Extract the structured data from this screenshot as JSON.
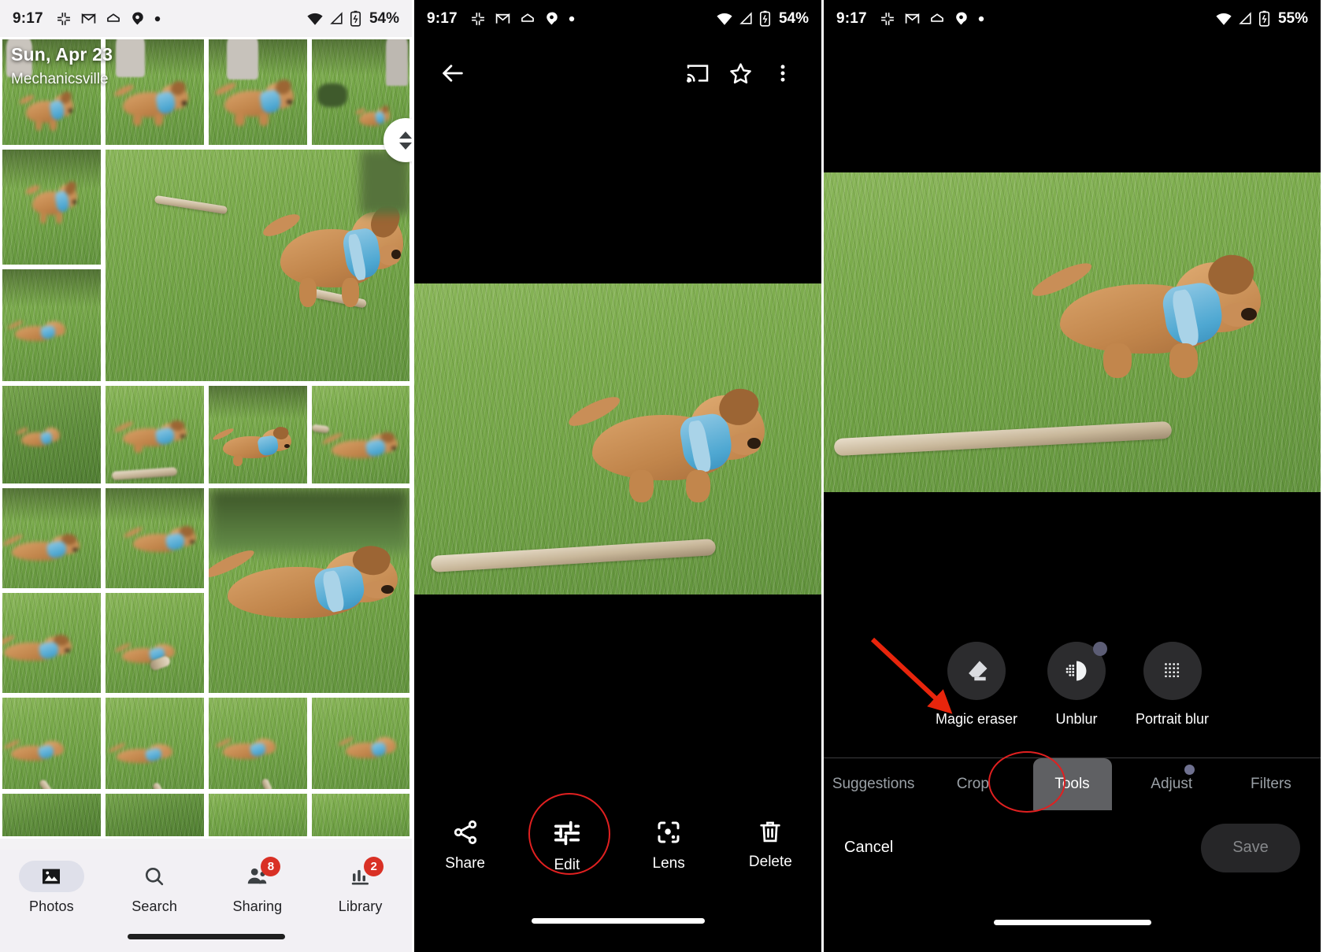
{
  "status_bars": [
    {
      "time": "9:17",
      "battery": "54%",
      "theme": "light",
      "icons": [
        "slack-icon",
        "gmail-icon",
        "home-icon",
        "maps-pin-icon",
        "dot-icon"
      ],
      "right_icons": [
        "wifi-icon",
        "signal-icon",
        "battery-charging-icon"
      ]
    },
    {
      "time": "9:17",
      "battery": "54%",
      "theme": "dark",
      "icons": [
        "slack-icon",
        "gmail-icon",
        "home-icon",
        "maps-pin-icon",
        "dot-icon"
      ],
      "right_icons": [
        "wifi-icon",
        "signal-icon",
        "battery-charging-icon"
      ]
    },
    {
      "time": "9:17",
      "battery": "55%",
      "theme": "dark",
      "icons": [
        "slack-icon",
        "gmail-icon",
        "home-icon",
        "maps-pin-icon",
        "dot-icon"
      ],
      "right_icons": [
        "wifi-icon",
        "signal-icon",
        "battery-charging-icon"
      ]
    }
  ],
  "panel_grid": {
    "header": {
      "date": "Sun, Apr 23",
      "location": "Mechanicsville"
    },
    "scroll_pill": {
      "up_icon": "chevron-up-icon",
      "down_icon": "chevron-down-icon"
    },
    "bottom_nav": [
      {
        "label": "Photos",
        "icon": "photos-icon",
        "active": true,
        "badge": ""
      },
      {
        "label": "Search",
        "icon": "search-icon",
        "active": false,
        "badge": ""
      },
      {
        "label": "Sharing",
        "icon": "sharing-icon",
        "active": false,
        "badge": "8"
      },
      {
        "label": "Library",
        "icon": "library-icon",
        "active": false,
        "badge": "2"
      }
    ]
  },
  "panel_viewer": {
    "top_bar": {
      "back_icon": "back-arrow-icon",
      "cast_icon": "cast-icon",
      "favorite_icon": "star-outline-icon",
      "overflow_icon": "more-vert-icon"
    },
    "actions": [
      {
        "label": "Share",
        "icon": "share-icon",
        "highlighted": false
      },
      {
        "label": "Edit",
        "icon": "tune-icon",
        "highlighted": true
      },
      {
        "label": "Lens",
        "icon": "lens-icon",
        "highlighted": false
      },
      {
        "label": "Delete",
        "icon": "trash-icon",
        "highlighted": false
      }
    ]
  },
  "panel_editor": {
    "tools": [
      {
        "label": "Magic eraser",
        "icon": "eraser-icon",
        "has_dot": false
      },
      {
        "label": "Unblur",
        "icon": "unblur-icon",
        "has_dot": true
      },
      {
        "label": "Portrait blur",
        "icon": "portrait-blur-icon",
        "has_dot": false
      }
    ],
    "tabs": [
      {
        "label": "Suggestions",
        "active": false,
        "has_dot": false
      },
      {
        "label": "Crop",
        "active": false,
        "has_dot": false
      },
      {
        "label": "Tools",
        "active": true,
        "has_dot": false
      },
      {
        "label": "Adjust",
        "active": false,
        "has_dot": true
      },
      {
        "label": "Filters",
        "active": false,
        "has_dot": false
      }
    ],
    "footer": {
      "cancel_label": "Cancel",
      "save_label": "Save"
    }
  },
  "annotations": {
    "accent_color": "#e02020",
    "arrow_color": "#e8250c",
    "arrow_target": "magic-eraser-tool",
    "highlight_targets": [
      "edit-action-button",
      "tools-tab"
    ]
  }
}
